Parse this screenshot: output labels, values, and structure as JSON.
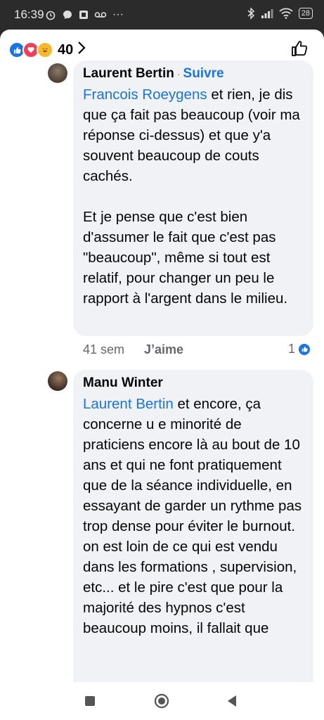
{
  "status": {
    "time": "16:39",
    "battery": "28"
  },
  "header": {
    "reaction_count": "40"
  },
  "comments": [
    {
      "author": "Laurent Bertin",
      "follow_label": "Suivre",
      "mention": "Francois Roeygens",
      "text1": " et rien, je dis que ça fait pas beaucoup (voir ma réponse ci-dessus) et que y'a souvent beaucoup de couts cachés.",
      "text2": "Et je pense que c'est bien d'assumer le fait que c'est pas \"beaucoup\", même si tout est relatif, pour changer un peu le rapport à l'argent dans le milieu.",
      "time": "41 sem",
      "like_label": "J’aime",
      "likes": "1"
    },
    {
      "author": "Manu Winter",
      "mention": "Laurent Bertin",
      "text1": " et encore, ça concerne u e minorité de praticiens encore là au bout de 10 ans et qui ne font pratiquement que de la séance individuelle,  en essayant de garder un rythme pas trop dense pour éviter le burnout. on  est loin de ce qui est vendu dans les formations , supervision, etc... et le pire c'est que pour la majorité des hypnos c'est beaucoup moins, il fallait que"
    }
  ],
  "colors": {
    "accent": "#1b74e4",
    "bubble": "#f0f2f5",
    "statusbar": "#2b2b2b"
  }
}
